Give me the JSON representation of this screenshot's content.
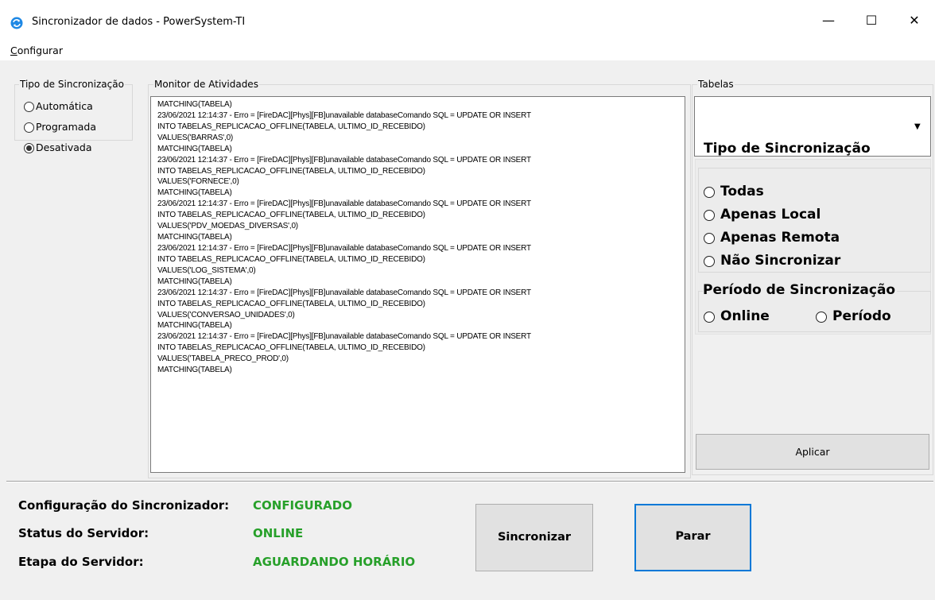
{
  "window": {
    "title": "Sincronizador de dados - PowerSystem-TI",
    "minimize_glyph": "—",
    "maximize_glyph": "☐",
    "close_glyph": "✕"
  },
  "menu": {
    "configurar_first": "C",
    "configurar_rest": "onfigurar"
  },
  "tipo_sync_left": {
    "legend": "Tipo de Sincronização",
    "options": [
      "Automática",
      "Programada",
      "Desativada"
    ],
    "selected": "Desativada"
  },
  "monitor": {
    "legend": "Monitor de Atividades",
    "log": "MATCHING(TABELA)\n23/06/2021 12:14:37 - Erro = [FireDAC][Phys][FB]unavailable databaseComando SQL = UPDATE OR INSERT\nINTO TABELAS_REPLICACAO_OFFLINE(TABELA, ULTIMO_ID_RECEBIDO)\nVALUES('BARRAS',0)\nMATCHING(TABELA)\n23/06/2021 12:14:37 - Erro = [FireDAC][Phys][FB]unavailable databaseComando SQL = UPDATE OR INSERT\nINTO TABELAS_REPLICACAO_OFFLINE(TABELA, ULTIMO_ID_RECEBIDO)\nVALUES('FORNECE',0)\nMATCHING(TABELA)\n23/06/2021 12:14:37 - Erro = [FireDAC][Phys][FB]unavailable databaseComando SQL = UPDATE OR INSERT\nINTO TABELAS_REPLICACAO_OFFLINE(TABELA, ULTIMO_ID_RECEBIDO)\nVALUES('PDV_MOEDAS_DIVERSAS',0)\nMATCHING(TABELA)\n23/06/2021 12:14:37 - Erro = [FireDAC][Phys][FB]unavailable databaseComando SQL = UPDATE OR INSERT\nINTO TABELAS_REPLICACAO_OFFLINE(TABELA, ULTIMO_ID_RECEBIDO)\nVALUES('LOG_SISTEMA',0)\nMATCHING(TABELA)\n23/06/2021 12:14:37 - Erro = [FireDAC][Phys][FB]unavailable databaseComando SQL = UPDATE OR INSERT\nINTO TABELAS_REPLICACAO_OFFLINE(TABELA, ULTIMO_ID_RECEBIDO)\nVALUES('CONVERSAO_UNIDADES',0)\nMATCHING(TABELA)\n23/06/2021 12:14:37 - Erro = [FireDAC][Phys][FB]unavailable databaseComando SQL = UPDATE OR INSERT\nINTO TABELAS_REPLICACAO_OFFLINE(TABELA, ULTIMO_ID_RECEBIDO)\nVALUES('TABELA_PRECO_PROD',0)\nMATCHING(TABELA)"
  },
  "tabelas": {
    "legend": "Tabelas",
    "selected_value": "",
    "dropdown_glyph": "▼",
    "tipo_legend": "Tipo de Sincronização",
    "tipo_options": [
      "Todas",
      "Apenas Local",
      "Apenas Remota",
      "Não Sincronizar"
    ],
    "periodo_legend": "Período de Sincronização",
    "periodo_options": [
      "Online",
      "Período"
    ],
    "apply_label": "Aplicar"
  },
  "status": {
    "config_label": "Configuração do Sincronizador:",
    "config_value": "CONFIGURADO",
    "server_label": "Status do Servidor:",
    "server_value": "ONLINE",
    "stage_label": "Etapa do Servidor:",
    "stage_value": "AGUARDANDO HORÁRIO",
    "value_color": "#27a02a"
  },
  "actions": {
    "sync_label": "Sincronizar",
    "stop_label": "Parar"
  }
}
